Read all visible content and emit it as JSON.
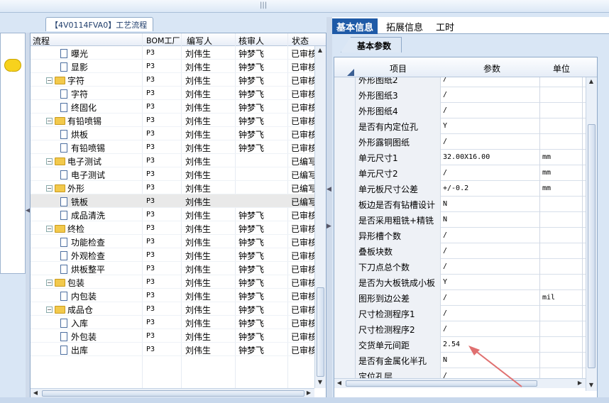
{
  "left_panel": {
    "title": "【4V0114FVA0】工艺流程",
    "headers": {
      "flow": "流程",
      "bom": "BOM工厂",
      "writer": "编写人",
      "reviewer": "核审人",
      "status": "状态"
    },
    "rows": [
      {
        "level": 2,
        "kind": "doc",
        "name": "曝光",
        "bom": "P3",
        "writer": "刘伟生",
        "reviewer": "钟梦飞",
        "status": "已审核"
      },
      {
        "level": 2,
        "kind": "doc",
        "name": "显影",
        "bom": "P3",
        "writer": "刘伟生",
        "reviewer": "钟梦飞",
        "status": "已审核"
      },
      {
        "level": 1,
        "kind": "folder",
        "name": "字符",
        "bom": "P3",
        "writer": "刘伟生",
        "reviewer": "钟梦飞",
        "status": "已审核"
      },
      {
        "level": 2,
        "kind": "doc",
        "name": "字符",
        "bom": "P3",
        "writer": "刘伟生",
        "reviewer": "钟梦飞",
        "status": "已审核"
      },
      {
        "level": 2,
        "kind": "doc",
        "name": "终固化",
        "bom": "P3",
        "writer": "刘伟生",
        "reviewer": "钟梦飞",
        "status": "已审核"
      },
      {
        "level": 1,
        "kind": "folder",
        "name": "有铅喷锡",
        "bom": "P3",
        "writer": "刘伟生",
        "reviewer": "钟梦飞",
        "status": "已审核"
      },
      {
        "level": 2,
        "kind": "doc",
        "name": "烘板",
        "bom": "P3",
        "writer": "刘伟生",
        "reviewer": "钟梦飞",
        "status": "已审核"
      },
      {
        "level": 2,
        "kind": "doc",
        "name": "有铅喷锡",
        "bom": "P3",
        "writer": "刘伟生",
        "reviewer": "钟梦飞",
        "status": "已审核"
      },
      {
        "level": 1,
        "kind": "folder",
        "name": "电子测试",
        "bom": "P3",
        "writer": "刘伟生",
        "reviewer": "",
        "status": "已编写"
      },
      {
        "level": 2,
        "kind": "doc",
        "name": "电子测试",
        "bom": "P3",
        "writer": "刘伟生",
        "reviewer": "",
        "status": "已编写"
      },
      {
        "level": 1,
        "kind": "folder",
        "name": "外形",
        "bom": "P3",
        "writer": "刘伟生",
        "reviewer": "",
        "status": "已编写"
      },
      {
        "level": 2,
        "kind": "doc",
        "name": "铣板",
        "bom": "P3",
        "writer": "刘伟生",
        "reviewer": "",
        "status": "已编写",
        "selected": true
      },
      {
        "level": 2,
        "kind": "doc",
        "name": "成品清洗",
        "bom": "P3",
        "writer": "刘伟生",
        "reviewer": "钟梦飞",
        "status": "已审核"
      },
      {
        "level": 1,
        "kind": "folder",
        "name": "终检",
        "bom": "P3",
        "writer": "刘伟生",
        "reviewer": "钟梦飞",
        "status": "已审核"
      },
      {
        "level": 2,
        "kind": "doc",
        "name": "功能检查",
        "bom": "P3",
        "writer": "刘伟生",
        "reviewer": "钟梦飞",
        "status": "已审核"
      },
      {
        "level": 2,
        "kind": "doc",
        "name": "外观检查",
        "bom": "P3",
        "writer": "刘伟生",
        "reviewer": "钟梦飞",
        "status": "已审核"
      },
      {
        "level": 2,
        "kind": "doc",
        "name": "烘板整平",
        "bom": "P3",
        "writer": "刘伟生",
        "reviewer": "钟梦飞",
        "status": "已审核"
      },
      {
        "level": 1,
        "kind": "folder",
        "name": "包装",
        "bom": "P3",
        "writer": "刘伟生",
        "reviewer": "钟梦飞",
        "status": "已审核"
      },
      {
        "level": 2,
        "kind": "doc",
        "name": "内包装",
        "bom": "P3",
        "writer": "刘伟生",
        "reviewer": "钟梦飞",
        "status": "已审核"
      },
      {
        "level": 1,
        "kind": "folder",
        "name": "成品仓",
        "bom": "P3",
        "writer": "刘伟生",
        "reviewer": "钟梦飞",
        "status": "已审核"
      },
      {
        "level": 2,
        "kind": "doc",
        "name": "入库",
        "bom": "P3",
        "writer": "刘伟生",
        "reviewer": "钟梦飞",
        "status": "已审核"
      },
      {
        "level": 2,
        "kind": "doc",
        "name": "外包装",
        "bom": "P3",
        "writer": "刘伟生",
        "reviewer": "钟梦飞",
        "status": "已审核"
      },
      {
        "level": 2,
        "kind": "doc",
        "name": "出库",
        "bom": "P3",
        "writer": "刘伟生",
        "reviewer": "钟梦飞",
        "status": "已审核"
      }
    ]
  },
  "right_panel": {
    "tabs": [
      "基本信息",
      "拓展信息",
      "工时"
    ],
    "active_tab": 0,
    "subtab": "基本参数",
    "headers": {
      "item": "项目",
      "param": "参数",
      "unit": "单位"
    },
    "rows": [
      {
        "name": "外形图纸2",
        "value": "/",
        "unit": ""
      },
      {
        "name": "外形图纸3",
        "value": "/",
        "unit": ""
      },
      {
        "name": "外形图纸4",
        "value": "/",
        "unit": ""
      },
      {
        "name": "是否有内定位孔",
        "value": "Y",
        "unit": ""
      },
      {
        "name": "外形露铜图纸",
        "value": "/",
        "unit": ""
      },
      {
        "name": "单元尺寸1",
        "value": "32.00X16.00",
        "unit": "mm"
      },
      {
        "name": "单元尺寸2",
        "value": "/",
        "unit": "mm"
      },
      {
        "name": "单元板尺寸公差",
        "value": "+/-0.2",
        "unit": "mm"
      },
      {
        "name": "板边是否有钻槽设计",
        "value": "N",
        "unit": ""
      },
      {
        "name": "是否采用粗铣+精铣",
        "value": "N",
        "unit": ""
      },
      {
        "name": "异形槽个数",
        "value": "/",
        "unit": ""
      },
      {
        "name": "叠板块数",
        "value": "/",
        "unit": ""
      },
      {
        "name": "下刀点总个数",
        "value": "/",
        "unit": ""
      },
      {
        "name": "是否为大板铣成小板",
        "value": "Y",
        "unit": ""
      },
      {
        "name": "图形到边公差",
        "value": "/",
        "unit": "mil"
      },
      {
        "name": "尺寸检测程序1",
        "value": "/",
        "unit": ""
      },
      {
        "name": "尺寸检测程序2",
        "value": "/",
        "unit": ""
      },
      {
        "name": "交货单元间距",
        "value": "2.54",
        "unit": ""
      },
      {
        "name": "是否有金属化半孔",
        "value": "N",
        "unit": ""
      },
      {
        "name": "定位孔层",
        "value": "/",
        "unit": ""
      }
    ]
  },
  "colors": {
    "tab_active": "#1e5aa7",
    "frame": "#d9e6f5",
    "annotation_arrow": "#e07070"
  }
}
